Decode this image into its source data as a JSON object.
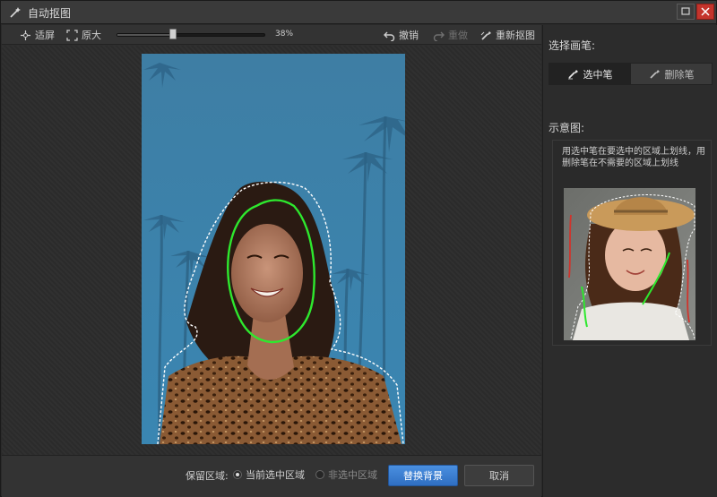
{
  "window": {
    "title": "自动抠图"
  },
  "toolbar": {
    "fit_label": "适屏",
    "actual_label": "原大",
    "zoom_percent": 38,
    "zoom_label": "38%",
    "undo_label": "撤销",
    "redo_label": "重做",
    "reset_label": "重新抠图"
  },
  "bottom": {
    "keep_area_label": "保留区域:",
    "options": [
      "当前选中区域",
      "非选中区域"
    ],
    "selected_option": 0,
    "replace_bg_label": "替换背景",
    "cancel_label": "取消"
  },
  "right_panel": {
    "brush_title": "选择画笔:",
    "brushes": [
      {
        "label": "选中笔",
        "active": true
      },
      {
        "label": "删除笔",
        "active": false
      }
    ],
    "example_title": "示意图:",
    "hint": "用选中笔在要选中的区域上划线，用删除笔在不需要的区域上划线"
  },
  "colors": {
    "accent": "#3a7fd5",
    "selection_stroke": "#2ee82e",
    "delete_stroke": "#d0342c",
    "close_button": "#c4342c"
  }
}
